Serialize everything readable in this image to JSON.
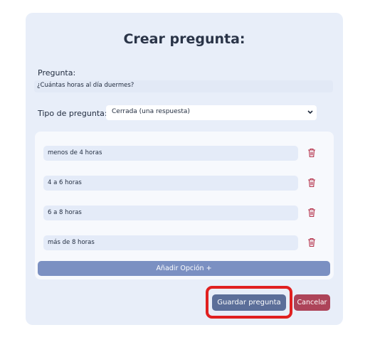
{
  "form": {
    "title": "Crear pregunta:",
    "question_label": "Pregunta:",
    "question_value": "¿Cuántas horas al día duermes?",
    "type_label": "Tipo de pregunta:",
    "type_selected": "Cerrada (una respuesta)"
  },
  "options": [
    {
      "text": "menos de 4 horas",
      "icon": "trash-icon"
    },
    {
      "text": "4 a 6 horas",
      "icon": "trash-icon"
    },
    {
      "text": "6 a 8 horas",
      "icon": "trash-icon"
    },
    {
      "text": "más de 8 horas",
      "icon": "trash-icon"
    }
  ],
  "buttons": {
    "add_option": "Añadir Opción +",
    "save": "Guardar pregunta",
    "cancel": "Cancelar"
  },
  "colors": {
    "card_bg": "#e8eef9",
    "add_button": "#7b90c2",
    "save_button": "#5b6e99",
    "cancel_button": "#ad4459",
    "trash_icon": "#b5314a",
    "highlight": "#e02020"
  }
}
